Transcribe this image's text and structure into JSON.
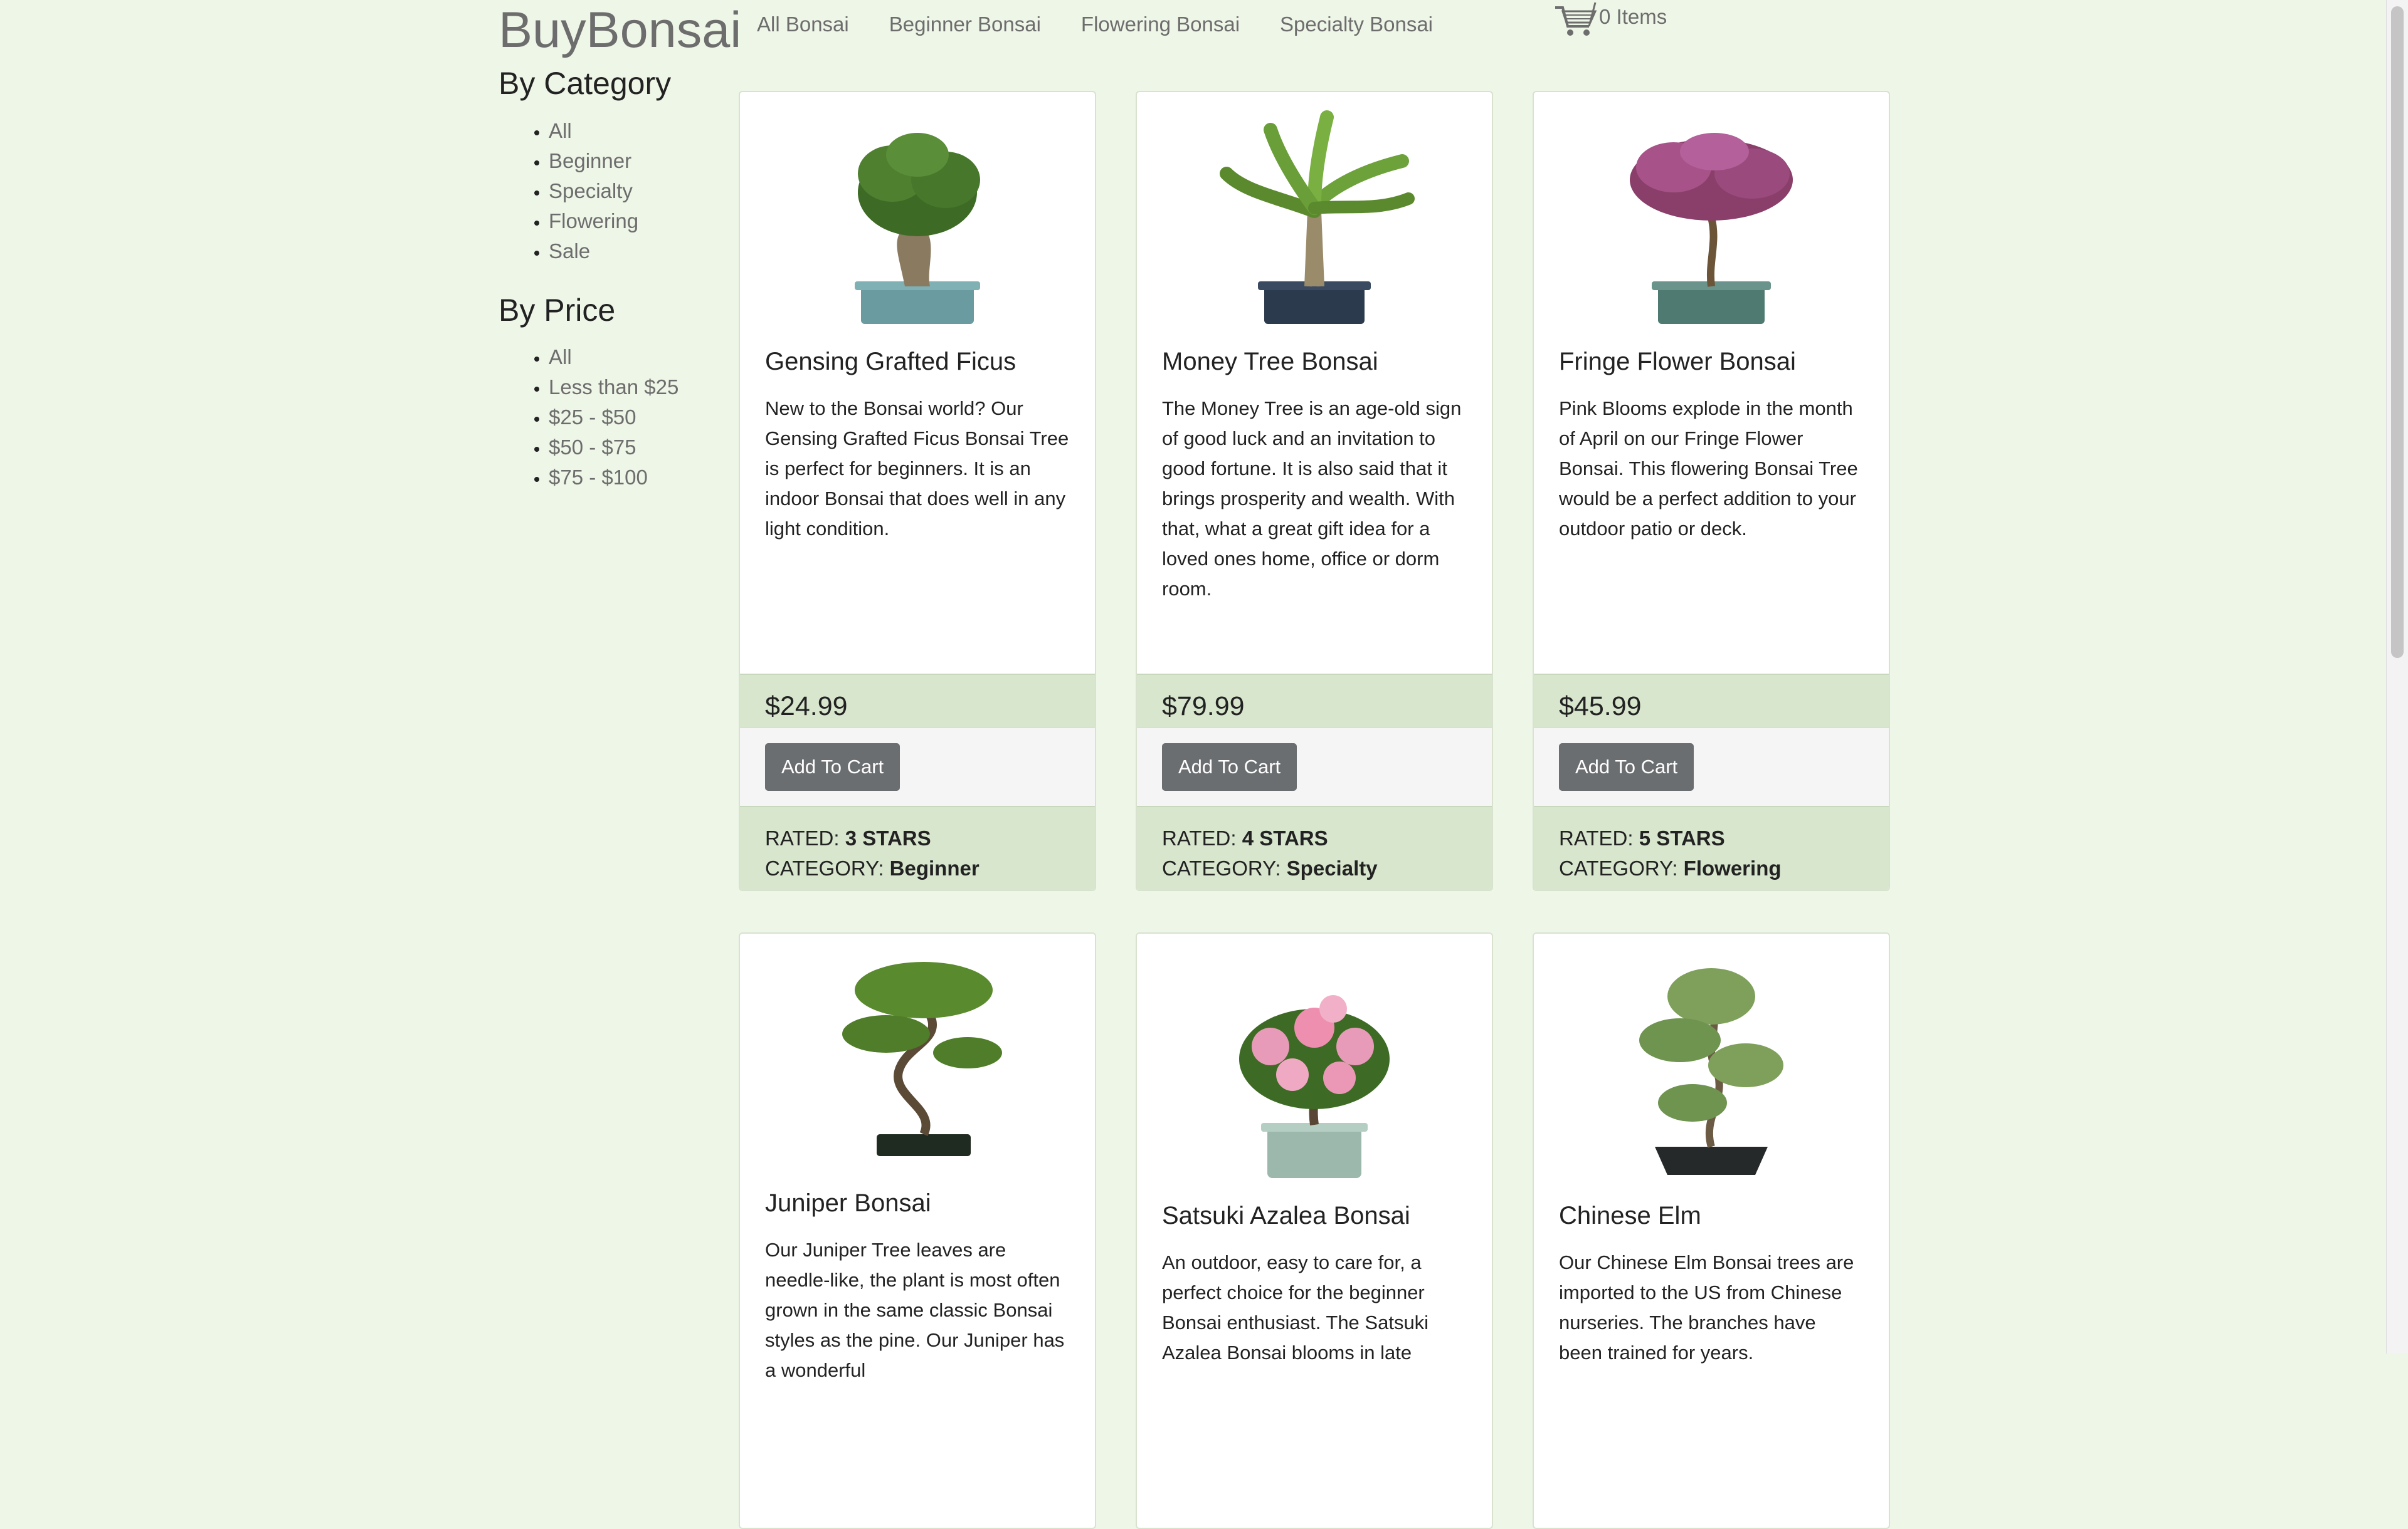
{
  "brand": "BuyBonsai",
  "nav": [
    "All Bonsai",
    "Beginner Bonsai",
    "Flowering Bonsai",
    "Specialty Bonsai"
  ],
  "cart": {
    "label": "0 Items",
    "icon": "cart-icon"
  },
  "sidebar": {
    "category_heading": "By Category",
    "categories": [
      "All",
      "Beginner",
      "Specialty",
      "Flowering",
      "Sale"
    ],
    "price_heading": "By Price",
    "prices": [
      "All",
      "Less than $25",
      "$25 - $50",
      "$50 - $75",
      "$75 - $100"
    ]
  },
  "labels": {
    "add_to_cart": "Add To Cart",
    "rated": "RATED:",
    "category": "CATEGORY:"
  },
  "products": [
    {
      "name": "Gensing Grafted Ficus",
      "description": "New to the Bonsai world? Our Gensing Grafted Ficus Bonsai Tree is perfect for beginners. It is an indoor Bonsai that does well in any light condition.",
      "price": "$24.99",
      "rating": "3 STARS",
      "category": "Beginner",
      "image": "ficus-bonsai-image"
    },
    {
      "name": "Money Tree Bonsai",
      "description": "The Money Tree is an age-old sign of good luck and an invitation to good fortune. It is also said that it brings prosperity and wealth. With that, what a great gift idea for a loved ones home, office or dorm room.",
      "price": "$79.99",
      "rating": "4 STARS",
      "category": "Specialty",
      "image": "money-tree-image"
    },
    {
      "name": "Fringe Flower Bonsai",
      "description": "Pink Blooms explode in the month of April on our Fringe Flower Bonsai. This flowering Bonsai Tree would be a perfect addition to your outdoor patio or deck.",
      "price": "$45.99",
      "rating": "5 STARS",
      "category": "Flowering",
      "image": "fringe-flower-image"
    },
    {
      "name": "Juniper Bonsai",
      "description": "Our Juniper Tree leaves are needle-like, the plant is most often grown in the same classic Bonsai styles as the pine. Our Juniper has a wonderful",
      "image": "juniper-bonsai-image"
    },
    {
      "name": "Satsuki Azalea Bonsai",
      "description": "An outdoor, easy to care for, a perfect choice for the beginner Bonsai enthusiast. The Satsuki Azalea Bonsai blooms in late",
      "image": "azalea-bonsai-image"
    },
    {
      "name": "Chinese Elm",
      "description": "Our Chinese Elm Bonsai trees are imported to the US from Chinese nurseries. The branches have been trained for years.",
      "image": "chinese-elm-image"
    }
  ],
  "colors": {
    "background": "#eef6e7",
    "price_band": "#d7e6cd",
    "button": "#6b6e70",
    "link": "#6d6d6d"
  }
}
